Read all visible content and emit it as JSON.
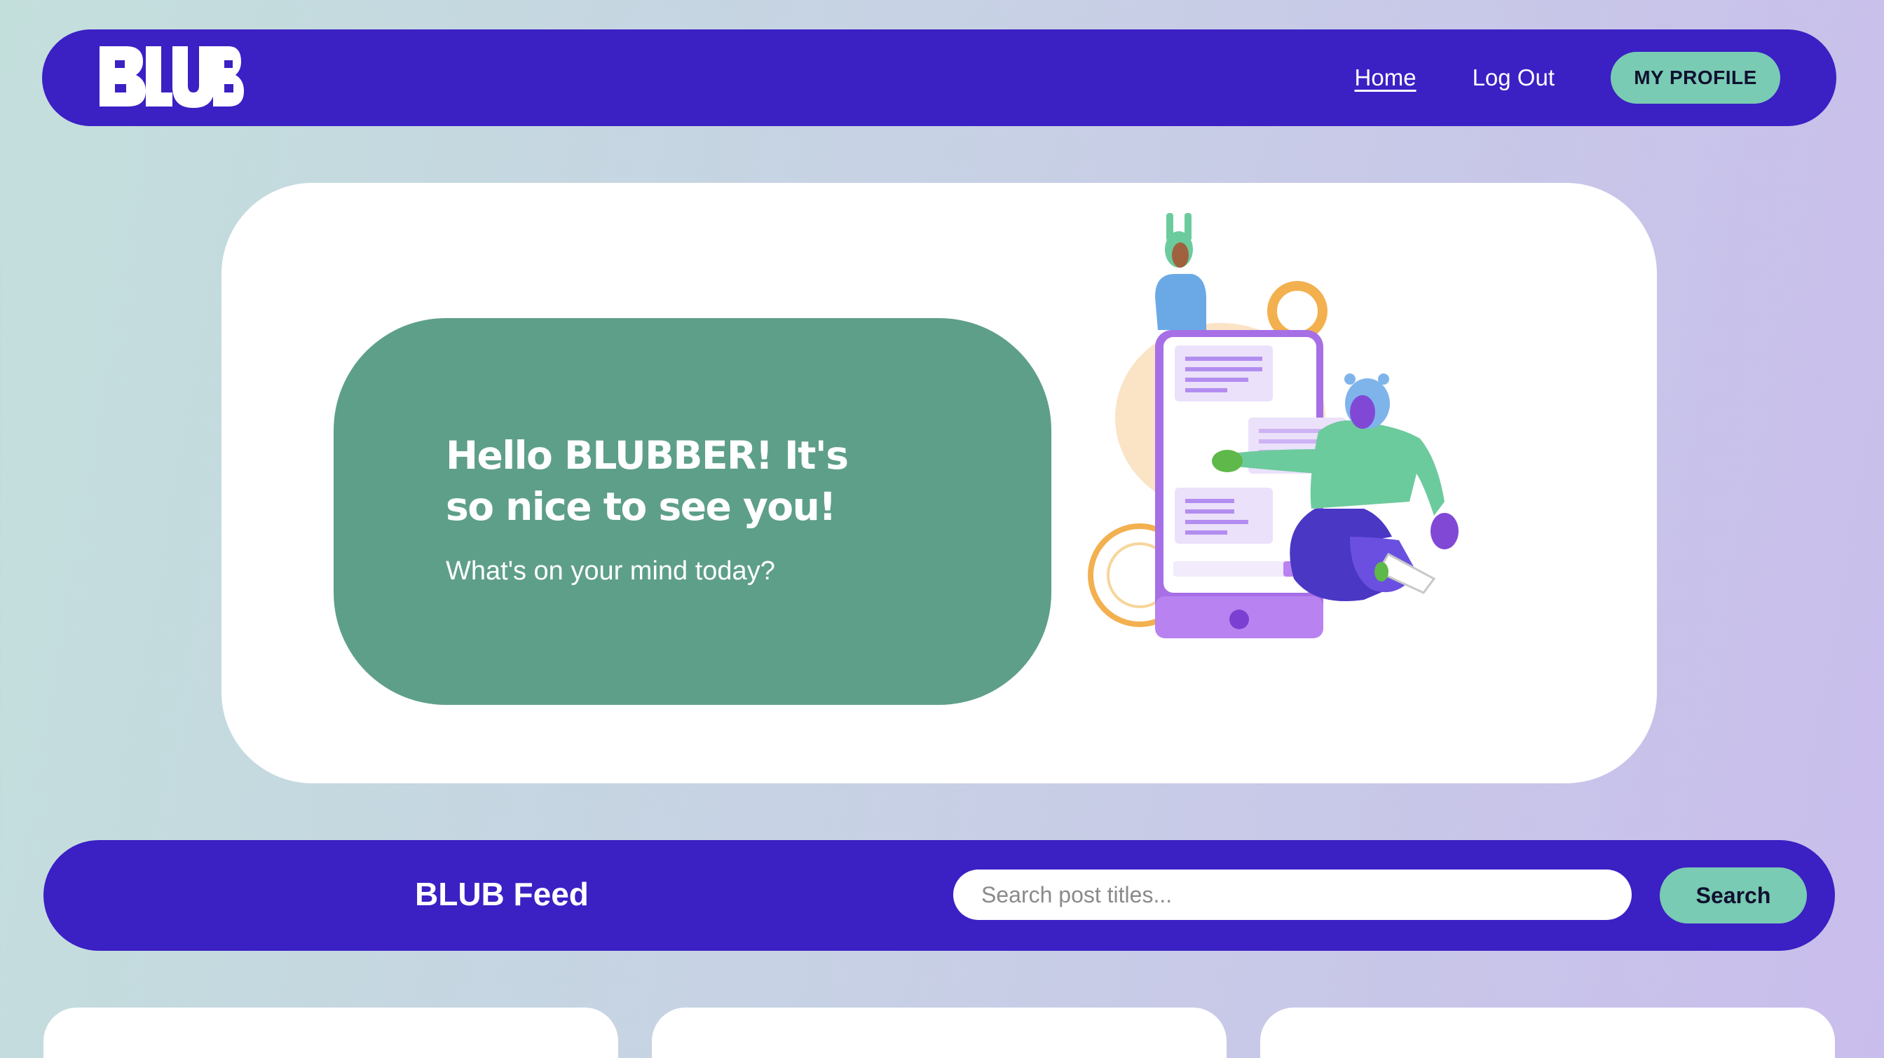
{
  "brand": {
    "logo_text": "BLUB"
  },
  "nav": {
    "home_label": "Home",
    "logout_label": "Log Out",
    "profile_label": "MY PROFILE"
  },
  "hero": {
    "heading": "Hello BLUBBER! It's so nice to see you!",
    "subheading": "What's on your mind today?"
  },
  "feed": {
    "title": "BLUB Feed",
    "search_placeholder": "Search post titles...",
    "search_value": "",
    "search_button_label": "Search",
    "posts": [
      {},
      {},
      {}
    ]
  },
  "colors": {
    "primary": "#3b20c4",
    "accent": "#79cbb3",
    "greeting_bg": "#5e9f8a",
    "card_bg": "#ffffff"
  }
}
